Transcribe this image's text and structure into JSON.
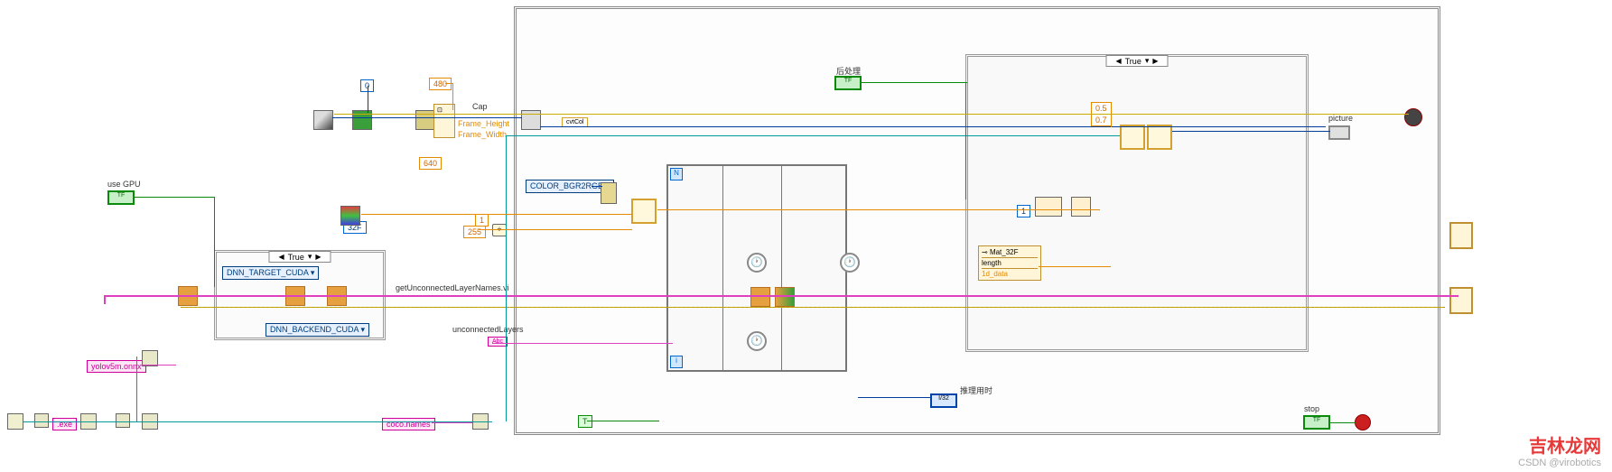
{
  "labels": {
    "use_gpu": "use GPU",
    "post_proc": "后处理",
    "infer_time": "推理用时",
    "stop": "stop",
    "picture": "picture",
    "get_layers": "getUnconnectedLayerNames.vi",
    "unconn_layers": "unconnectedLayers",
    "frame_h": "Frame_Height",
    "frame_w": "Frame_Width",
    "cap": "Cap"
  },
  "constants": {
    "zero": "0",
    "c480": "480",
    "c640": "640",
    "c640b": "640",
    "c255": "255",
    "c1": "1",
    "true": "T",
    "c05": "0.5",
    "c07": "0.7",
    "i1": "1",
    "t32f": "32F"
  },
  "enums": {
    "dnn_target": "DNN_TARGET_CUDA",
    "dnn_backend": "DNN_BACKEND_CUDA",
    "color_conv": "COLOR_BGR2RGB",
    "cvtcol": "cvtCol"
  },
  "strings": {
    "model": "yolov5m.onnx",
    "names": "coco.names",
    "exe": ".exe",
    "abc": "Abc"
  },
  "case_labels": {
    "true1": "True",
    "true2": "True"
  },
  "unbundle": {
    "mat32f": "Mat_32F",
    "length": "length",
    "data1d": "1d_data"
  },
  "terminals": {
    "i32": "I/32",
    "tf": "TF"
  },
  "watermark": {
    "main": "吉林龙网",
    "sub": "CSDN @virobotics"
  }
}
